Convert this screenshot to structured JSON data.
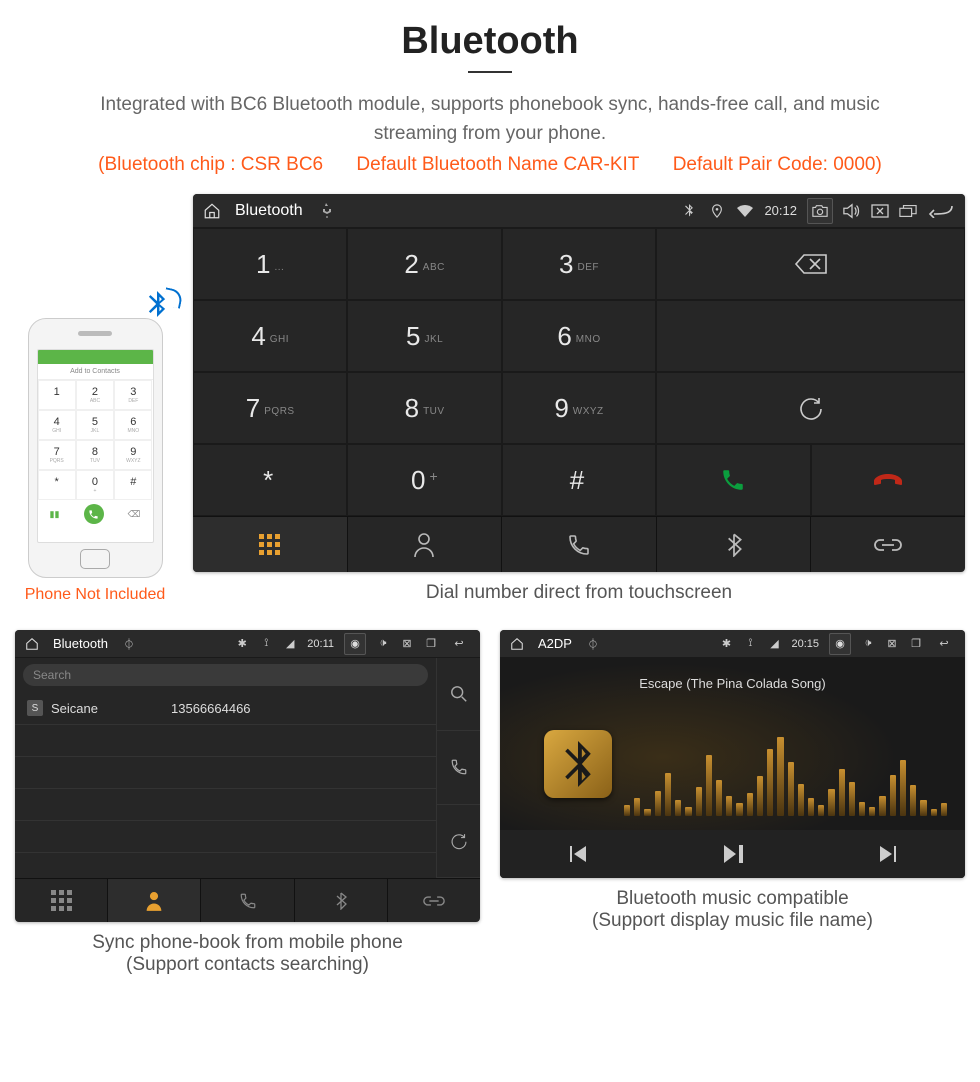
{
  "header": {
    "title": "Bluetooth",
    "desc": "Integrated with BC6 Bluetooth module, supports phonebook sync, hands-free call, and music streaming from your phone.",
    "spec1": "(Bluetooth chip : CSR BC6",
    "spec2": "Default Bluetooth Name CAR-KIT",
    "spec3": "Default Pair Code: 0000)"
  },
  "phone": {
    "add_contacts": "Add to Contacts",
    "note": "Phone Not Included",
    "keys": [
      {
        "n": "1",
        "l": ""
      },
      {
        "n": "2",
        "l": "ABC"
      },
      {
        "n": "3",
        "l": "DEF"
      },
      {
        "n": "4",
        "l": "GHI"
      },
      {
        "n": "5",
        "l": "JKL"
      },
      {
        "n": "6",
        "l": "MNO"
      },
      {
        "n": "7",
        "l": "PQRS"
      },
      {
        "n": "8",
        "l": "TUV"
      },
      {
        "n": "9",
        "l": "WXYZ"
      },
      {
        "n": "*",
        "l": ""
      },
      {
        "n": "0",
        "l": "+"
      },
      {
        "n": "#",
        "l": ""
      }
    ]
  },
  "dialer": {
    "status": {
      "title": "Bluetooth",
      "time": "20:12"
    },
    "keys": [
      {
        "n": "1",
        "l": "..."
      },
      {
        "n": "2",
        "l": "ABC"
      },
      {
        "n": "3",
        "l": "DEF"
      },
      {
        "n": "4",
        "l": "GHI"
      },
      {
        "n": "5",
        "l": "JKL"
      },
      {
        "n": "6",
        "l": "MNO"
      },
      {
        "n": "7",
        "l": "PQRS"
      },
      {
        "n": "8",
        "l": "TUV"
      },
      {
        "n": "9",
        "l": "WXYZ"
      },
      {
        "n": "*",
        "l": ""
      },
      {
        "n": "0",
        "l": "+"
      },
      {
        "n": "#",
        "l": ""
      }
    ],
    "caption": "Dial number direct from touchscreen"
  },
  "phonebook": {
    "status": {
      "title": "Bluetooth",
      "time": "20:11"
    },
    "search_placeholder": "Search",
    "contact": {
      "badge": "S",
      "name": "Seicane",
      "number": "13566664466"
    },
    "caption1": "Sync phone-book from mobile phone",
    "caption2": "(Support contacts searching)"
  },
  "music": {
    "status": {
      "title": "A2DP",
      "time": "20:15"
    },
    "track": "Escape (The Pina Colada Song)",
    "caption1": "Bluetooth music compatible",
    "caption2": "(Support display music file name)"
  }
}
